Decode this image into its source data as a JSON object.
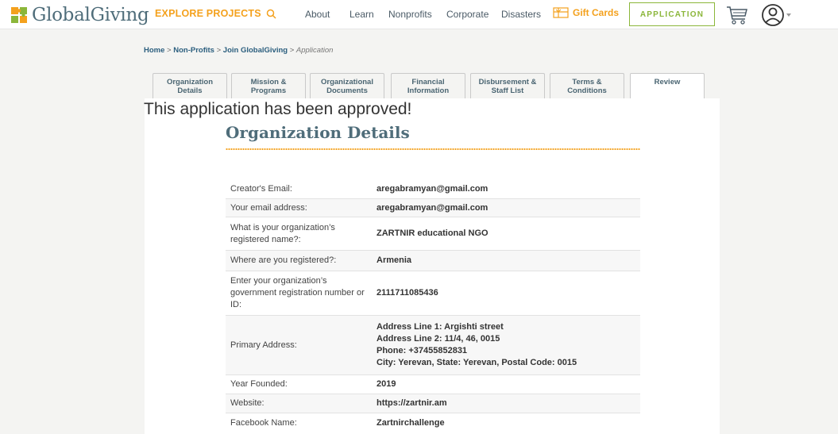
{
  "header": {
    "logo_text": "GlobalGiving",
    "explore_label": "EXPLORE PROJECTS",
    "nav": [
      "About",
      "Learn",
      "Nonprofits",
      "Corporate",
      "Disasters"
    ],
    "gift_cards_label": "Gift Cards",
    "application_label": "APPLICATION"
  },
  "breadcrumb": {
    "home": "Home",
    "sep": " > ",
    "nonprofits": "Non-Profits",
    "join": "Join GlobalGiving",
    "current": "Application"
  },
  "tabs": [
    {
      "line1": "Organization",
      "line2": "Details"
    },
    {
      "line1": "Mission &",
      "line2": "Programs"
    },
    {
      "line1": "Organizational",
      "line2": "Documents"
    },
    {
      "line1": "Financial",
      "line2": "Information"
    },
    {
      "line1": "Disbursement &",
      "line2": "Staff List"
    },
    {
      "line1": "Terms &",
      "line2": "Conditions"
    },
    {
      "line1": "Review",
      "line2": ""
    }
  ],
  "status_message": "This application has been approved!",
  "section_title": "Organization Details",
  "details": [
    {
      "label": "Creator's Email:",
      "value": "aregabramyan@gmail.com"
    },
    {
      "label": "Your email address:",
      "value": "aregabramyan@gmail.com"
    },
    {
      "label": "What is your organization’s registered name?:",
      "value": "ZARTNIR educational NGO"
    },
    {
      "label": "Where are you registered?:",
      "value": "Armenia"
    },
    {
      "label": "Enter your organization’s government registration number or ID:",
      "value": "2111711085436"
    },
    {
      "label": "Primary Address:",
      "value_lines": [
        "Address Line 1: Argishti street",
        "Address Line 2: 11/4, 46, 0015",
        "Phone: +37455852831",
        "City: Yerevan, State: Yerevan, Postal Code: 0015"
      ]
    },
    {
      "label": "Year Founded:",
      "value": "2019"
    },
    {
      "label": "Website:",
      "value": "https://zartnir.am"
    },
    {
      "label": "Facebook Name:",
      "value": "Zartnirchallenge"
    }
  ],
  "colors": {
    "brand_orange": "#f4a11d",
    "brand_green": "#8bb63a",
    "brand_slate": "#4f6d7a"
  },
  "icons": [
    "logo-puzzle-icon",
    "search-icon",
    "gift-icon",
    "cart-icon",
    "user-icon",
    "chevron-down-icon"
  ]
}
